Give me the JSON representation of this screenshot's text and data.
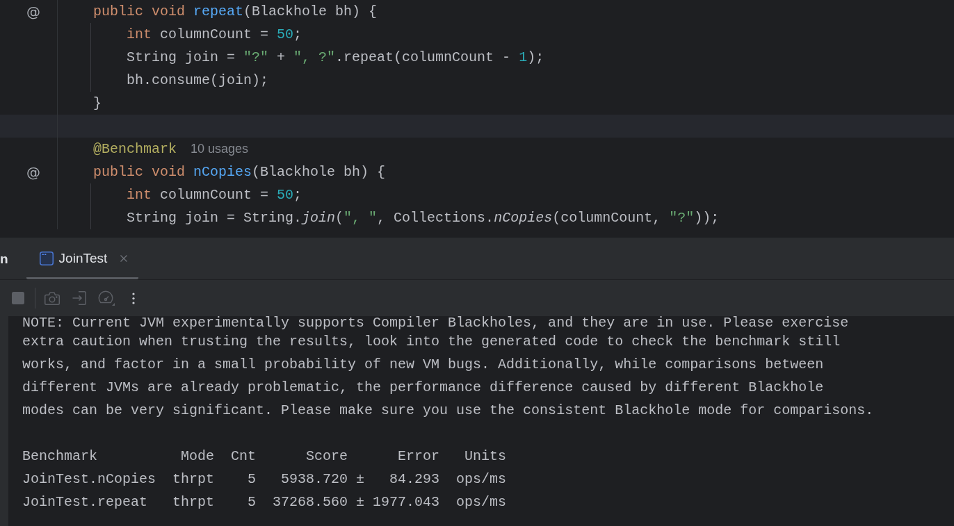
{
  "editor": {
    "lines": [
      {
        "current": false,
        "gutter_mark": "@",
        "tokens": [
          {
            "kind": "keyword",
            "text": "public void "
          },
          {
            "kind": "method",
            "text": "repeat"
          },
          {
            "kind": "plain",
            "text": "(Blackhole bh) {"
          }
        ],
        "children": [
          {
            "current": false,
            "tokens": [
              {
                "kind": "keyword",
                "text": "int "
              },
              {
                "kind": "plain",
                "text": "columnCount = "
              },
              {
                "kind": "number",
                "text": "50"
              },
              {
                "kind": "plain",
                "text": ";"
              }
            ]
          },
          {
            "current": false,
            "tokens": [
              {
                "kind": "plain",
                "text": "String join = "
              },
              {
                "kind": "string",
                "text": "\"?\""
              },
              {
                "kind": "plain",
                "text": " + "
              },
              {
                "kind": "string",
                "text": "\", ?\""
              },
              {
                "kind": "plain",
                "text": ".repeat(columnCount - "
              },
              {
                "kind": "number",
                "text": "1"
              },
              {
                "kind": "plain",
                "text": ");"
              }
            ]
          },
          {
            "current": false,
            "tokens": [
              {
                "kind": "plain",
                "text": "bh.consume(join);"
              }
            ]
          }
        ]
      },
      {
        "current": false,
        "tokens": [
          {
            "kind": "plain",
            "text": "}"
          }
        ]
      },
      {
        "current": true
      },
      {
        "current": false,
        "tokens": [
          {
            "kind": "annotation",
            "text": "@Benchmark"
          }
        ],
        "hint": "10 usages"
      },
      {
        "current": false,
        "gutter_mark": "@",
        "tokens": [
          {
            "kind": "keyword",
            "text": "public void "
          },
          {
            "kind": "method",
            "text": "nCopies"
          },
          {
            "kind": "plain",
            "text": "(Blackhole bh) {"
          }
        ],
        "children": [
          {
            "current": false,
            "tokens": [
              {
                "kind": "keyword",
                "text": "int "
              },
              {
                "kind": "plain",
                "text": "columnCount = "
              },
              {
                "kind": "number",
                "text": "50"
              },
              {
                "kind": "plain",
                "text": ";"
              }
            ]
          },
          {
            "current": false,
            "tokens": [
              {
                "kind": "plain",
                "text": "String join = String."
              },
              {
                "kind": "static_call",
                "text": "join"
              },
              {
                "kind": "plain",
                "text": "("
              },
              {
                "kind": "string",
                "text": "\", \""
              },
              {
                "kind": "plain",
                "text": ", Collections."
              },
              {
                "kind": "static_call",
                "text": "nCopies"
              },
              {
                "kind": "plain",
                "text": "(columnCount, "
              },
              {
                "kind": "string",
                "text": "\"?\""
              },
              {
                "kind": "plain",
                "text": "));"
              }
            ]
          }
        ]
      }
    ]
  },
  "run_panel": {
    "title": "n",
    "tabs": [
      {
        "label": "JoinTest",
        "selected": true
      }
    ],
    "toolbar": {
      "groups": [
        {
          "buttons": [
            {
              "kind": "stop",
              "disabled": true
            }
          ]
        },
        {
          "buttons": [
            {
              "kind": "camera",
              "disabled": true
            },
            {
              "kind": "enter",
              "disabled": true
            },
            {
              "kind": "gauge",
              "disabled": true
            },
            {
              "kind": "more",
              "disabled": false
            }
          ]
        }
      ]
    }
  },
  "console": {
    "lines": [
      "NOTE: Current JVM experimentally supports Compiler Blackholes, and they are in use. Please exercise",
      "extra caution when trusting the results, look into the generated code to check the benchmark still",
      "works, and factor in a small probability of new VM bugs. Additionally, while comparisons between",
      "different JVMs are already problematic, the performance difference caused by different Blackhole",
      "modes can be very significant. Please make sure you use the consistent Blackhole mode for comparisons."
    ],
    "results_table": {
      "header": {
        "benchmark": "Benchmark",
        "mode": "Mode",
        "cnt": "Cnt",
        "score": "Score",
        "error": "Error",
        "units": "Units"
      },
      "rows": [
        {
          "benchmark": "JoinTest.nCopies",
          "mode": "thrpt",
          "cnt": "5",
          "score": "5938.720",
          "sign": "±",
          "error": "84.293",
          "units": "ops/ms"
        },
        {
          "benchmark": "JoinTest.repeat",
          "mode": "thrpt",
          "cnt": "5",
          "score": "37268.560",
          "sign": "±",
          "error": "1977.043",
          "units": "ops/ms"
        }
      ]
    }
  }
}
